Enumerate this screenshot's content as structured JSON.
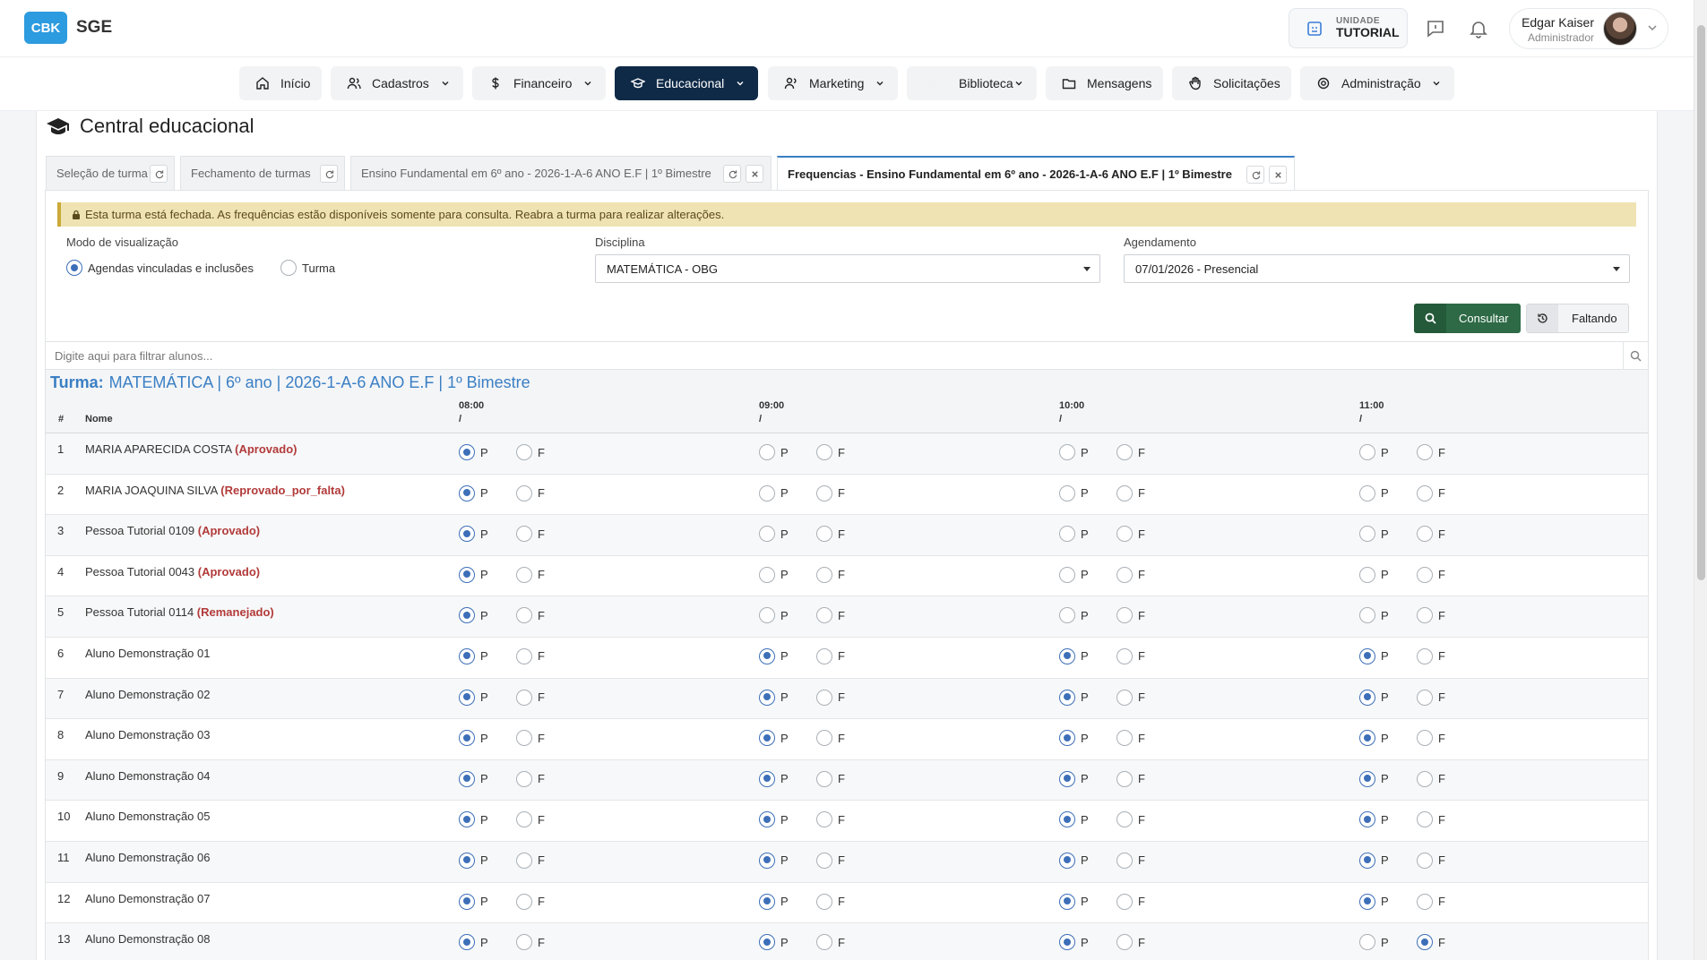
{
  "header": {
    "logo_badge": "CBK",
    "app_name": "SGE",
    "unit_label_small": "UNIDADE",
    "unit_label_big": "TUTORIAL",
    "user_name": "Edgar Kaiser",
    "user_role": "Administrador"
  },
  "nav": [
    {
      "label": "Início",
      "icon": "home-icon"
    },
    {
      "label": "Cadastros",
      "icon": "users-icon"
    },
    {
      "label": "Financeiro",
      "icon": "dollar-icon"
    },
    {
      "label": "Educacional",
      "icon": "graduation-cap-icon"
    },
    {
      "label": "Marketing",
      "icon": "users-icon"
    },
    {
      "label": "Biblioteca",
      "icon": "book-icon"
    },
    {
      "label": "Mensagens",
      "icon": "folder-icon"
    },
    {
      "label": "Solicitações",
      "icon": "hand-icon"
    },
    {
      "label": "Administração",
      "icon": "gear-icon"
    }
  ],
  "page": {
    "title": "Central educacional",
    "tabs": [
      {
        "label": "Seleção de turma"
      },
      {
        "label": "Fechamento de turmas"
      },
      {
        "label": "Ensino Fundamental em 6º ano - 2026-1-A-6 ANO E.F | 1º Bimestre"
      },
      {
        "label": "Frequencias - Ensino Fundamental em 6º ano - 2026-1-A-6 ANO E.F | 1º Bimestre"
      }
    ],
    "alert": "Esta turma está fechada. As frequências estão disponíveis somente para consulta. Reabra a turma para realizar alterações."
  },
  "form": {
    "view_mode_label": "Modo de visualização",
    "view_mode_option1": "Agendas vinculadas e inclusões",
    "view_mode_option2": "Turma",
    "discipline_label": "Disciplina",
    "discipline_value": "MATEMÁTICA - OBG",
    "schedule_label": "Agendamento",
    "schedule_value": "07/01/2026 - Presencial",
    "consultar_label": "Consultar",
    "faltando_label": "Faltando",
    "filter_placeholder": "Digite aqui para filtrar alunos..."
  },
  "table": {
    "turma_prefix": "Turma:",
    "turma_name": "MATEMÁTICA | 6º ano | 2026-1-A-6 ANO E.F | 1º Bimestre",
    "col_num": "#",
    "col_name": "Nome",
    "times": [
      "08:00",
      "09:00",
      "10:00",
      "11:00"
    ],
    "time_sub": "/",
    "present_label": "P",
    "absent_label": "F",
    "rows": [
      {
        "num": "1",
        "name": "MARIA APARECIDA COSTA",
        "status": "(Aprovado)",
        "marks": [
          "P",
          "",
          "",
          ""
        ]
      },
      {
        "num": "2",
        "name": "MARIA JOAQUINA SILVA",
        "status": "(Reprovado_por_falta)",
        "marks": [
          "P",
          "",
          "",
          ""
        ]
      },
      {
        "num": "3",
        "name": "Pessoa Tutorial 0109",
        "status": "(Aprovado)",
        "marks": [
          "P",
          "",
          "",
          ""
        ]
      },
      {
        "num": "4",
        "name": "Pessoa Tutorial 0043",
        "status": "(Aprovado)",
        "marks": [
          "P",
          "",
          "",
          ""
        ]
      },
      {
        "num": "5",
        "name": "Pessoa Tutorial 0114",
        "status": "(Remanejado)",
        "marks": [
          "P",
          "",
          "",
          ""
        ]
      },
      {
        "num": "6",
        "name": "Aluno Demonstração 01",
        "status": "",
        "marks": [
          "P",
          "P",
          "P",
          "P"
        ]
      },
      {
        "num": "7",
        "name": "Aluno Demonstração 02",
        "status": "",
        "marks": [
          "P",
          "P",
          "P",
          "P"
        ]
      },
      {
        "num": "8",
        "name": "Aluno Demonstração 03",
        "status": "",
        "marks": [
          "P",
          "P",
          "P",
          "P"
        ]
      },
      {
        "num": "9",
        "name": "Aluno Demonstração 04",
        "status": "",
        "marks": [
          "P",
          "P",
          "P",
          "P"
        ]
      },
      {
        "num": "10",
        "name": "Aluno Demonstração 05",
        "status": "",
        "marks": [
          "P",
          "P",
          "P",
          "P"
        ]
      },
      {
        "num": "11",
        "name": "Aluno Demonstração 06",
        "status": "",
        "marks": [
          "P",
          "P",
          "P",
          "P"
        ]
      },
      {
        "num": "12",
        "name": "Aluno Demonstração 07",
        "status": "",
        "marks": [
          "P",
          "P",
          "P",
          "P"
        ]
      },
      {
        "num": "13",
        "name": "Aluno Demonstração 08",
        "status": "",
        "marks": [
          "P",
          "P",
          "P",
          "F"
        ]
      }
    ]
  }
}
